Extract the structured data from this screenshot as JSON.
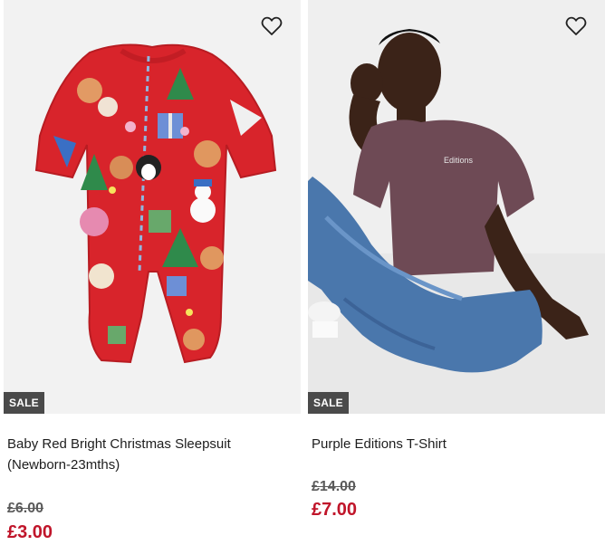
{
  "products": [
    {
      "name": "Baby Red Bright Christmas Sleepsuit (Newborn-23mths)",
      "badge": "SALE",
      "was_price": "£6.00",
      "now_price": "£3.00",
      "image_icon": "christmas-sleepsuit-photo",
      "wishlist_icon": "heart-icon"
    },
    {
      "name": "Purple Editions T-Shirt",
      "badge": "SALE",
      "was_price": "£14.00",
      "now_price": "£7.00",
      "image_icon": "model-purple-tshirt-photo",
      "wishlist_icon": "heart-icon"
    }
  ],
  "colors": {
    "sale_badge_bg": "#4a4a4a",
    "now_price": "#c0152a",
    "was_price": "#5a5a5a",
    "sleepsuit_red": "#d8242b",
    "tshirt_purple": "#6e4a55",
    "jeans_blue": "#4a77ac"
  }
}
